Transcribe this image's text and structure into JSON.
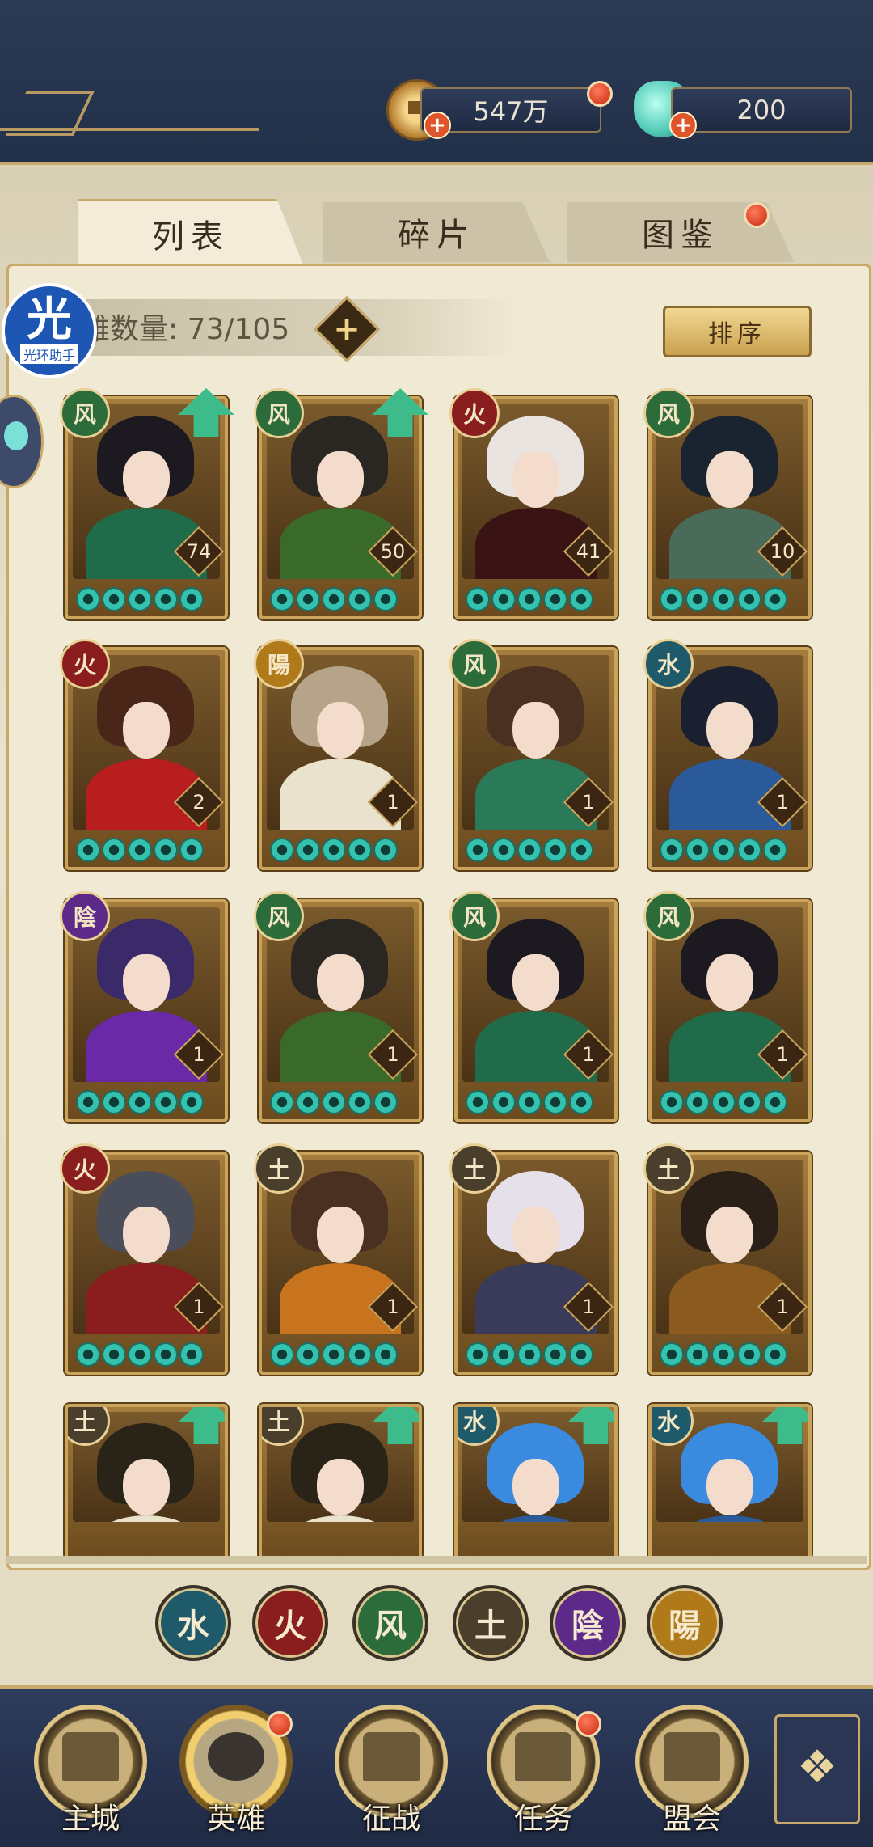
{
  "header": {
    "coins": "547万",
    "gems": "200",
    "coin_icon": "copper-coin-icon",
    "gem_icon": "jade-gem-icon"
  },
  "tabs": [
    {
      "label": "列表"
    },
    {
      "label": "碎片"
    },
    {
      "label": "图鉴"
    }
  ],
  "list": {
    "hero_count": "雄数量: 73/105",
    "sort_label": "排序"
  },
  "watermark": {
    "big": "光",
    "small": "光环助手"
  },
  "heroes": [
    {
      "element": "风",
      "elem_class": "e-wind",
      "level": "74",
      "up": true,
      "hair": "#1c1a20",
      "body": "#1f6b4a"
    },
    {
      "element": "风",
      "elem_class": "e-wind",
      "level": "50",
      "up": true,
      "hair": "#2a2622",
      "body": "#3a6a2a"
    },
    {
      "element": "火",
      "elem_class": "e-fire",
      "level": "41",
      "up": false,
      "hair": "#e9e4e0",
      "body": "#3a1414"
    },
    {
      "element": "风",
      "elem_class": "e-wind",
      "level": "10",
      "up": false,
      "hair": "#1a2430",
      "body": "#4a6a5a"
    },
    {
      "element": "火",
      "elem_class": "e-fire",
      "level": "2",
      "up": false,
      "hair": "#4a2618",
      "body": "#b81e1e"
    },
    {
      "element": "陽",
      "elem_class": "e-yang",
      "level": "1",
      "up": false,
      "hair": "#b5a48a",
      "body": "#e9e2cc"
    },
    {
      "element": "风",
      "elem_class": "e-wind",
      "level": "1",
      "up": false,
      "hair": "#4a3020",
      "body": "#2a7a5a"
    },
    {
      "element": "水",
      "elem_class": "e-water",
      "level": "1",
      "up": false,
      "hair": "#1a2030",
      "body": "#2a5a9a"
    },
    {
      "element": "陰",
      "elem_class": "e-yin",
      "level": "1",
      "up": false,
      "hair": "#3a2a6a",
      "body": "#6a2aa8"
    },
    {
      "element": "风",
      "elem_class": "e-wind",
      "level": "1",
      "up": false,
      "hair": "#2a2622",
      "body": "#3a6a2a"
    },
    {
      "element": "风",
      "elem_class": "e-wind",
      "level": "1",
      "up": false,
      "hair": "#1c1a20",
      "body": "#1f6b4a"
    },
    {
      "element": "风",
      "elem_class": "e-wind",
      "level": "1",
      "up": false,
      "hair": "#1c1a20",
      "body": "#1f6b4a"
    },
    {
      "element": "火",
      "elem_class": "e-fire",
      "level": "1",
      "up": false,
      "hair": "#4a4e5a",
      "body": "#8a1e1e"
    },
    {
      "element": "土",
      "elem_class": "e-earth",
      "level": "1",
      "up": false,
      "hair": "#4a3020",
      "body": "#c8741e"
    },
    {
      "element": "土",
      "elem_class": "e-earth",
      "level": "1",
      "up": false,
      "hair": "#e6e0ea",
      "body": "#3a3a5a"
    },
    {
      "element": "土",
      "elem_class": "e-earth",
      "level": "1",
      "up": false,
      "hair": "#2a2018",
      "body": "#8a5a1e"
    },
    {
      "element": "土",
      "elem_class": "e-earth",
      "level": "",
      "up": true,
      "hair": "#2a2418",
      "body": "#e9e2cc"
    },
    {
      "element": "土",
      "elem_class": "e-earth",
      "level": "",
      "up": true,
      "hair": "#2a2418",
      "body": "#e9e2cc"
    },
    {
      "element": "水",
      "elem_class": "e-water",
      "level": "",
      "up": true,
      "hair": "#3a8ae0",
      "body": "#2a5a9a"
    },
    {
      "element": "水",
      "elem_class": "e-water",
      "level": "",
      "up": true,
      "hair": "#3a8ae0",
      "body": "#2a5a9a"
    }
  ],
  "filters": [
    {
      "label": "水",
      "color": "#1f5a6a"
    },
    {
      "label": "火",
      "color": "#8a1e1e"
    },
    {
      "label": "风",
      "color": "#2c6b3a"
    },
    {
      "label": "土",
      "color": "#4a3e2c"
    },
    {
      "label": "陰",
      "color": "#5e2a8a"
    },
    {
      "label": "陽",
      "color": "#b07a1a"
    }
  ],
  "nav": [
    {
      "label": "主城",
      "icon": "city-gate-icon"
    },
    {
      "label": "英雄",
      "icon": "hero-portrait-icon"
    },
    {
      "label": "征战",
      "icon": "battle-drum-icon"
    },
    {
      "label": "任务",
      "icon": "task-scroll-icon"
    },
    {
      "label": "盟会",
      "icon": "alliance-pavilion-icon"
    }
  ],
  "menu_icon": "knot-menu-icon"
}
